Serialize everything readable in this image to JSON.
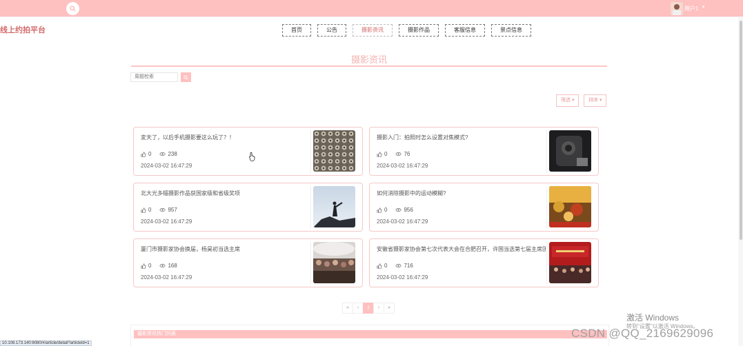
{
  "header": {
    "site_title": "线上约拍平台",
    "user_label": "用户1",
    "user_caret": "▾",
    "nav": [
      "首页",
      "公告",
      "摄影资讯",
      "摄影作品",
      "客服信息",
      "景点信息"
    ],
    "active_nav": "摄影资讯"
  },
  "section": {
    "title": "摄影资讯",
    "search_placeholder": "周题检索",
    "filter_label": "筛选",
    "sort_label": "排序"
  },
  "articles": [
    {
      "title": "変天了，以后手机摄影要这么玩了？！",
      "likes": "0",
      "views": "238",
      "time": "2024-03-02 16:47:29"
    },
    {
      "title": "摄影入门：拍照时怎么设置对焦模式?",
      "likes": "0",
      "views": "76",
      "time": "2024-03-02 16:47:29"
    },
    {
      "title": "北大光多幅摄影作品获国家级和省级奖项",
      "likes": "0",
      "views": "957",
      "time": "2024-03-02 16:47:29"
    },
    {
      "title": "如何消除摄影中的运动模糊?",
      "likes": "0",
      "views": "956",
      "time": "2024-03-02 16:47:29"
    },
    {
      "title": "厦门市摄影家协会换届，杨昊初当选主席",
      "likes": "0",
      "views": "168",
      "time": "2024-03-02 16:47:29"
    },
    {
      "title": "安徽省摄影家协会第七次代表大会在合肥召开，许国当选第七届主席团",
      "likes": "0",
      "views": "716",
      "time": "2024-03-02 16:47:29"
    }
  ],
  "pager": {
    "first": "«",
    "prev": "‹",
    "current": "1",
    "next": "›",
    "last": "»"
  },
  "hot": {
    "title": "摄影资讯热门列表"
  },
  "status_url": "10.108.173.140:8080/#/article/detail?articleId=1",
  "watermarks": {
    "windows_line1": "激活 Windows",
    "windows_line2": "转到\"设置\"以激活 Windows。",
    "csdn": "CSDN @QQ_2169629096"
  },
  "colors": {
    "accent": "#ffc0c0",
    "title_red": "#d36a6a"
  }
}
